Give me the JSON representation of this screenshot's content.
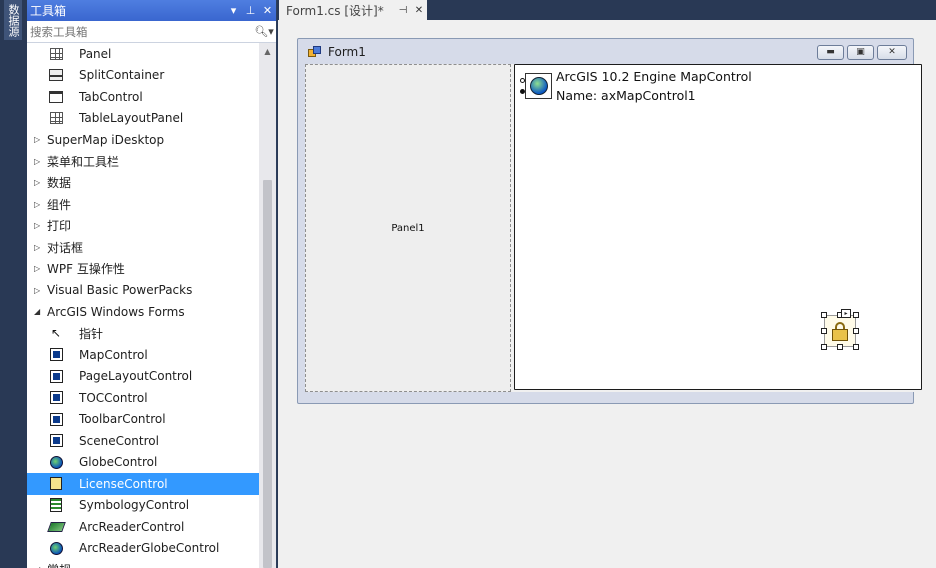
{
  "side_strip": {
    "label": "数据源"
  },
  "toolbox": {
    "title": "工具箱",
    "header_buttons": [
      "▾",
      "⊥",
      "✕"
    ],
    "search_placeholder": "搜索工具箱",
    "rows": [
      {
        "kind": "item",
        "label": "Panel",
        "icon": "grid-icon"
      },
      {
        "kind": "item",
        "label": "SplitContainer",
        "icon": "split-container-icon"
      },
      {
        "kind": "item",
        "label": "TabControl",
        "icon": "tab-control-icon"
      },
      {
        "kind": "item",
        "label": "TableLayoutPanel",
        "icon": "table-layout-icon"
      },
      {
        "kind": "group",
        "label": "SuperMap iDesktop",
        "expanded": false
      },
      {
        "kind": "group",
        "label": "菜单和工具栏",
        "expanded": false
      },
      {
        "kind": "group",
        "label": "数据",
        "expanded": false
      },
      {
        "kind": "group",
        "label": "组件",
        "expanded": false
      },
      {
        "kind": "group",
        "label": "打印",
        "expanded": false
      },
      {
        "kind": "group",
        "label": "对话框",
        "expanded": false
      },
      {
        "kind": "group",
        "label": "WPF 互操作性",
        "expanded": false
      },
      {
        "kind": "group",
        "label": "Visual Basic PowerPacks",
        "expanded": false
      },
      {
        "kind": "group",
        "label": "ArcGIS Windows Forms",
        "expanded": true
      },
      {
        "kind": "item",
        "label": "指针",
        "icon": "pointer-icon"
      },
      {
        "kind": "item",
        "label": "MapControl",
        "icon": "map-control-icon"
      },
      {
        "kind": "item",
        "label": "PageLayoutControl",
        "icon": "page-layout-control-icon"
      },
      {
        "kind": "item",
        "label": "TOCControl",
        "icon": "toc-control-icon"
      },
      {
        "kind": "item",
        "label": "ToolbarControl",
        "icon": "toolbar-control-icon"
      },
      {
        "kind": "item",
        "label": "SceneControl",
        "icon": "scene-control-icon"
      },
      {
        "kind": "item",
        "label": "GlobeControl",
        "icon": "globe-icon"
      },
      {
        "kind": "item",
        "label": "LicenseControl",
        "icon": "license-control-icon",
        "selected": true
      },
      {
        "kind": "item",
        "label": "SymbologyControl",
        "icon": "symbology-control-icon"
      },
      {
        "kind": "item",
        "label": "ArcReaderControl",
        "icon": "arcreader-control-icon"
      },
      {
        "kind": "item",
        "label": "ArcReaderGlobeControl",
        "icon": "arcreader-globe-control-icon"
      },
      {
        "kind": "group",
        "label": "常规",
        "expanded": true
      }
    ]
  },
  "document": {
    "tab_label": "Form1.cs [设计]*",
    "tab_buttons": [
      "⊣",
      "✕"
    ]
  },
  "form": {
    "title": "Form1",
    "panel1_label": "Panel1",
    "map_control": {
      "line1": "ArcGIS 10.2 Engine MapControl",
      "line2": "Name: axMapControl1"
    },
    "smart_tag": "▸"
  },
  "colors": {
    "selection": "#3399ff",
    "header": "#3d6bd6",
    "ide_background": "#293955"
  }
}
